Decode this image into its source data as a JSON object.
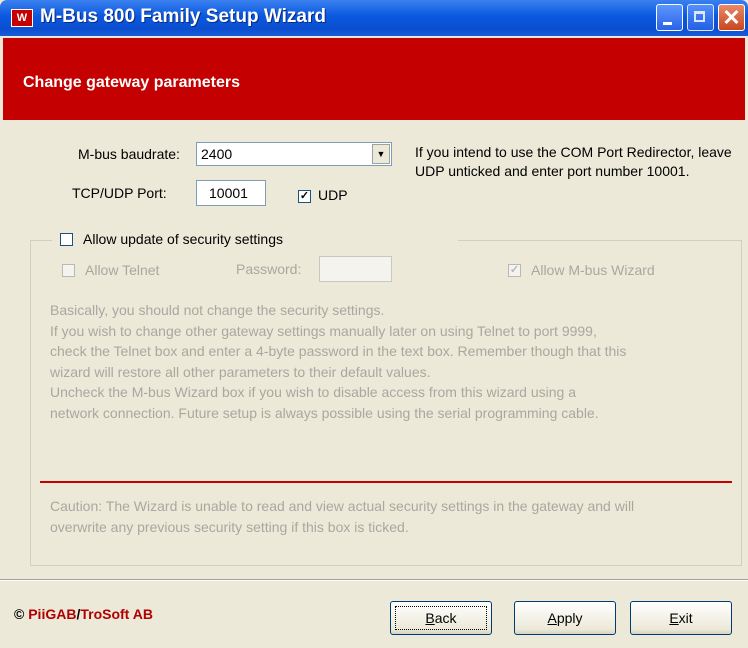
{
  "window": {
    "title": "M-Bus 800 Family Setup Wizard",
    "app_icon_letter": "W",
    "colors": {
      "titlebar": "#0a58e0",
      "banner": "#c40000",
      "dialog": "#ece9d8"
    }
  },
  "banner": {
    "title": "Change gateway parameters"
  },
  "settings": {
    "baudrate_label": "M-bus baudrate:",
    "baudrate_value": "2400",
    "port_label": "TCP/UDP Port:",
    "port_value": "10001",
    "udp_label": "UDP",
    "udp_checked": true,
    "info_text": "If you intend to use the COM Port Redirector, leave UDP unticked and enter port number 10001."
  },
  "security": {
    "group_label": "Allow update of security settings",
    "group_checked": false,
    "telnet_label": "Allow Telnet",
    "telnet_checked": false,
    "password_label": "Password:",
    "password_value": "",
    "wizard_label": "Allow M-bus Wizard",
    "wizard_checked": true,
    "explanation_lines": [
      "Basically, you should not change the security settings.",
      "If you wish to change other gateway settings manually later on using Telnet to port 9999,",
      "check the Telnet box and enter a 4-byte password in the text box. Remember though that this",
      "wizard will restore all other parameters to their default values.",
      "Uncheck the M-bus Wizard box if you wish to disable access from this wizard using a",
      "network connection. Future setup is always possible using the serial programming cable."
    ],
    "caution_lines": [
      "Caution: The Wizard is unable to read and view actual security settings in the gateway and will",
      "overwrite any previous security setting if this box is ticked."
    ]
  },
  "footer": {
    "copyright_symbol": "©",
    "brand_1": "PiiGAB",
    "slash": "/",
    "brand_2": "TroSoft AB",
    "back_accel": "B",
    "back_rest": "ack",
    "apply_accel": "A",
    "apply_rest": "pply",
    "exit_accel": "E",
    "exit_rest": "xit"
  }
}
